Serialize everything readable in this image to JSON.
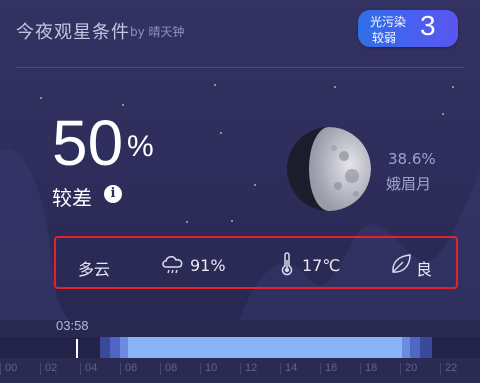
{
  "header": {
    "title": "今夜观星条件",
    "by": "by 晴天钟"
  },
  "pollution": {
    "label_line1": "光污染",
    "label_line2": "较弱",
    "value": "3"
  },
  "score": {
    "value": "50",
    "unit": "%",
    "rating": "较差"
  },
  "moon": {
    "illumination": "38.6%",
    "phase": "娥眉月"
  },
  "conditions": {
    "weather": "多云",
    "humidity": "91%",
    "temperature": "17℃",
    "air_quality": "良"
  },
  "timeline": {
    "current_time": "03:58",
    "ticks": [
      "00",
      "02",
      "04",
      "06",
      "08",
      "10",
      "12",
      "14",
      "16",
      "18",
      "20",
      "22"
    ]
  },
  "colors": {
    "badge": "#3f66ea",
    "timeline_fill": "#8ab4f8",
    "highlight_box": "#e0242a"
  }
}
